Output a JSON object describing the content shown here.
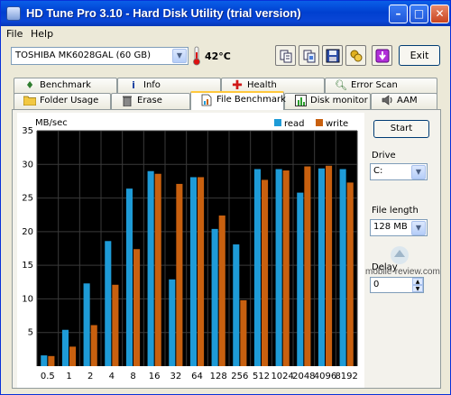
{
  "window": {
    "title": "HD Tune Pro 3.10 - Hard Disk Utility (trial version)",
    "controls": [
      "minimize",
      "maximize",
      "close"
    ]
  },
  "menu": {
    "items": [
      "File",
      "Help"
    ]
  },
  "toolbar": {
    "drive": "TOSHIBA MK6028GAL (60 GB)",
    "temperature": "42°C",
    "exit_label": "Exit",
    "icons": [
      "copy-text-icon",
      "copy-info-icon",
      "save-icon",
      "options-icon",
      "download-icon"
    ]
  },
  "tabs": {
    "row1": [
      "Benchmark",
      "Info",
      "Health",
      "Error Scan"
    ],
    "row2": [
      "Folder Usage",
      "Erase",
      "File Benchmark",
      "Disk monitor",
      "AAM"
    ],
    "active": "File Benchmark"
  },
  "side_panel": {
    "start_label": "Start",
    "drive_label": "Drive",
    "drive_value": "C:",
    "file_length_label": "File length",
    "file_length_value": "128 MB",
    "delay_label": "Delay",
    "delay_value": "0"
  },
  "watermark": "mobile-review.com",
  "colors": {
    "read": "#1E9BD7",
    "write": "#C8600F",
    "grid": "#3a3a3a",
    "plot_bg": "#000000"
  },
  "chart_data": {
    "type": "bar",
    "ylabel": "MB/sec",
    "ylim": [
      0,
      35
    ],
    "yticks": [
      5,
      10,
      15,
      20,
      25,
      30,
      35
    ],
    "categories": [
      "0.5",
      "1",
      "2",
      "4",
      "8",
      "16",
      "32",
      "64",
      "128",
      "256",
      "512",
      "1024",
      "2048",
      "4096",
      "8192"
    ],
    "series": [
      {
        "name": "read",
        "values": [
          1.6,
          5.4,
          12.3,
          18.6,
          26.4,
          29.0,
          12.9,
          28.1,
          20.4,
          18.1,
          29.3,
          29.3,
          25.8,
          29.4,
          29.3
        ]
      },
      {
        "name": "write",
        "values": [
          1.5,
          2.9,
          6.1,
          12.1,
          17.4,
          28.6,
          27.1,
          28.1,
          22.4,
          9.8,
          27.7,
          29.1,
          29.7,
          29.8,
          27.3
        ]
      }
    ],
    "legend": "top-right",
    "grid": true
  }
}
